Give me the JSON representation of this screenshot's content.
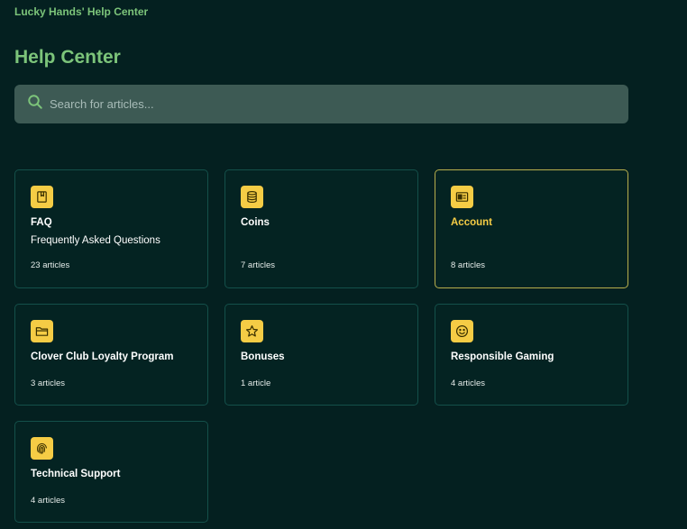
{
  "header": {
    "brand": "Lucky Hands' Help Center",
    "title": "Help Center"
  },
  "search": {
    "placeholder": "Search for articles..."
  },
  "colors": {
    "background": "#042020",
    "accent_green": "#7cc47a",
    "icon_yellow": "#f5cc45",
    "card_border": "#14504a",
    "card_border_active": "#b8ae4c"
  },
  "categories": [
    {
      "name": "FAQ",
      "description": "Frequently Asked Questions",
      "count": "23 articles",
      "icon": "book-icon"
    },
    {
      "name": "Coins",
      "description": "",
      "count": "7 articles",
      "icon": "coins-icon"
    },
    {
      "name": "Account",
      "description": "",
      "count": "8 articles",
      "icon": "id-card-icon",
      "active": true
    },
    {
      "name": "Clover Club Loyalty Program",
      "description": "",
      "count": "3 articles",
      "icon": "folder-icon"
    },
    {
      "name": "Bonuses",
      "description": "",
      "count": "1 article",
      "icon": "star-icon"
    },
    {
      "name": "Responsible Gaming",
      "description": "",
      "count": "4 articles",
      "icon": "smiley-icon"
    },
    {
      "name": "Technical Support",
      "description": "",
      "count": "4 articles",
      "icon": "fingerprint-icon"
    }
  ]
}
